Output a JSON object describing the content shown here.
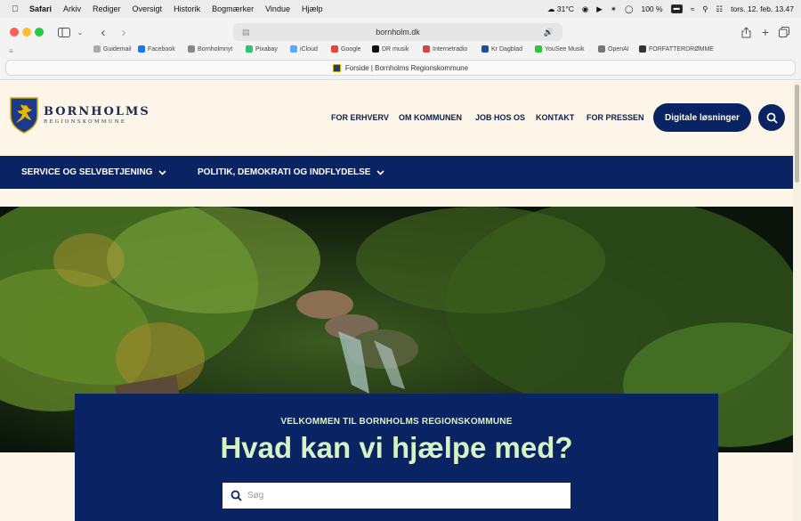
{
  "menubar": {
    "app": "Safari",
    "items": [
      "Arkiv",
      "Rediger",
      "Oversigt",
      "Historik",
      "Bogmærker",
      "Vindue",
      "Hjælp"
    ],
    "weather": "31°C",
    "battery": "100 %",
    "datetime": "tors. 12. feb. 13.47"
  },
  "browser": {
    "url": "bornholm.dk",
    "tab_title": "Forside | Bornholms Regionskommune",
    "bookmarks": [
      {
        "label": "Guidemail",
        "color": "#aaaaaa"
      },
      {
        "label": "Facebook",
        "color": "#1877f2"
      },
      {
        "label": "Bornholmnyt",
        "color": "#888888"
      },
      {
        "label": "Pixabay",
        "color": "#2ec66d"
      },
      {
        "label": "iCloud",
        "color": "#5aa9ff"
      },
      {
        "label": "Google",
        "color": "#ea4335"
      },
      {
        "label": "DR musik",
        "color": "#111111"
      },
      {
        "label": "Internetradio",
        "color": "#d64541"
      },
      {
        "label": "Kr Dagblad",
        "color": "#1f4e9c"
      },
      {
        "label": "YouSee Musik",
        "color": "#2bc73a"
      },
      {
        "label": "OpenAI",
        "color": "#777777"
      },
      {
        "label": "FORFATTERDRØMME",
        "color": "#333333"
      }
    ]
  },
  "site": {
    "logo": {
      "name": "BORNHOLMS",
      "sub": "REGIONSKOMMUNE"
    },
    "topnav": [
      "FOR ERHVERV",
      "OM KOMMUNEN",
      "JOB HOS OS",
      "KONTAKT",
      "FOR PRESSEN"
    ],
    "cta": "Digitale løsninger",
    "mainnav": [
      "SERVICE OG SELVBETJENING",
      "POLITIK, DEMOKRATI OG INDFLYDELSE"
    ],
    "welcome": {
      "subtitle": "VELKOMMEN TIL BORNHOLMS REGIONSKOMMUNE",
      "title": "Hvad kan vi hjælpe med?",
      "search_placeholder": "Søg"
    },
    "colors": {
      "primary": "#0a2463",
      "accent": "#d6f3c4",
      "background": "#fdf6e8"
    }
  }
}
